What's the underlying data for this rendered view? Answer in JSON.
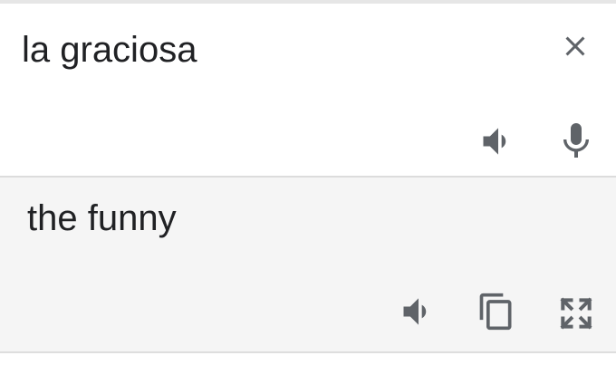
{
  "source": {
    "text": "la graciosa",
    "clear_icon": "close-icon",
    "listen_icon": "speaker-icon",
    "voice_icon": "microphone-icon"
  },
  "translation": {
    "text": "the funny",
    "listen_icon": "speaker-icon",
    "copy_icon": "copy-icon",
    "fullscreen_icon": "fullscreen-icon"
  },
  "colors": {
    "text": "#202124",
    "icon": "#5f6368",
    "source_background": "#ffffff",
    "translation_background": "#f5f5f5",
    "divider": "#dcdcdc"
  }
}
